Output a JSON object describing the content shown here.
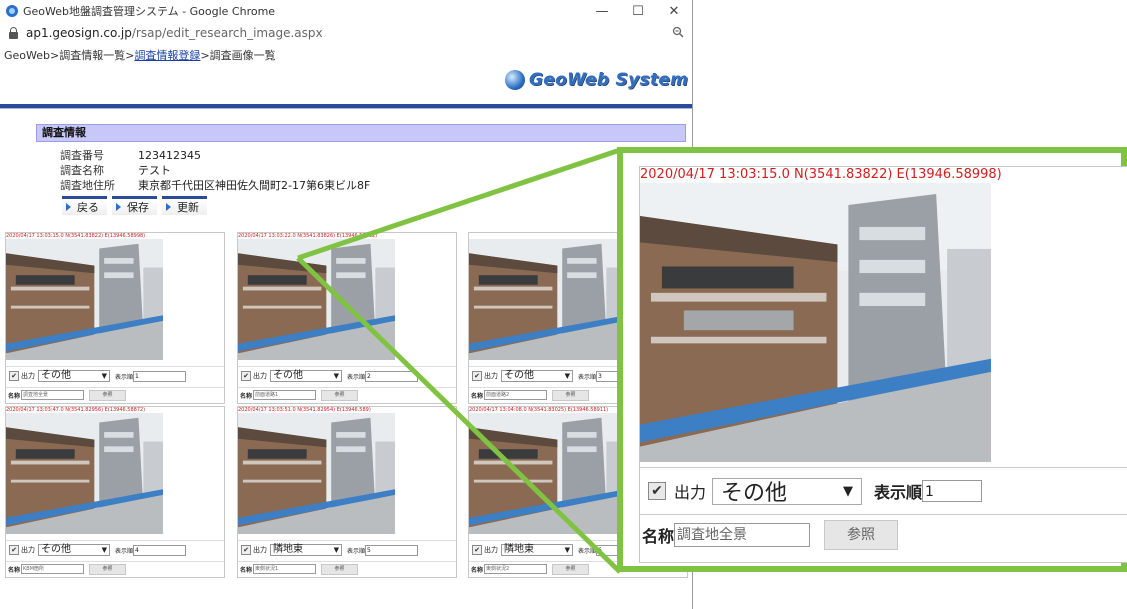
{
  "window": {
    "title": "GeoWeb地盤調査管理システム - Google Chrome",
    "url_host": "ap1.geosign.co.jp",
    "url_path": "/rsap/edit_research_image.aspx",
    "zoom_icon": "zoom-icon",
    "minimize": "—",
    "maximize": "☐",
    "close": "✕"
  },
  "breadcrumb": {
    "part1": "GeoWeb>調査情報一覧>",
    "link": "調査情報登録",
    "part2": ">調査画像一覧"
  },
  "logo": {
    "text": "GeoWeb System"
  },
  "info": {
    "heading": "調査情報",
    "rows": [
      {
        "label": "調査番号",
        "value": "123412345"
      },
      {
        "label": "調査名称",
        "value": "テスト"
      },
      {
        "label": "調査地住所",
        "value": "東京都千代田区神田佐久間町2-17第6東ビル8F"
      }
    ],
    "buttons": {
      "back": "戻る",
      "save": "保存",
      "update": "更新"
    }
  },
  "labels": {
    "output": "出力",
    "order": "表示順",
    "name": "名称",
    "browse": "参照",
    "check": "✔",
    "caret": "▼"
  },
  "cards": [
    {
      "ts": "2020/04/17 13:03:15.0 N(3541.83822) E(13946.58998)",
      "category": "その他",
      "order": "1",
      "name": "調査地全景"
    },
    {
      "ts": "2020/04/17 13:03:22.0 N(3541.83826) E(13946.58962)",
      "category": "その他",
      "order": "2",
      "name": "前面道路1"
    },
    {
      "ts": "",
      "category": "その他",
      "order": "3",
      "name": "前面道路2"
    },
    {
      "ts": "2020/04/17 13:03:47.0 N(3541.82956) E(13946.58872)",
      "category": "その他",
      "order": "4",
      "name": "KBM箇所"
    },
    {
      "ts": "2020/04/17 13:03:51.0 N(3541.82954) E(13946.589)",
      "category": "隣地東",
      "order": "5",
      "name": "東側状況1"
    },
    {
      "ts": "2020/04/17 13:04:08.0 N(3541.83025) E(13946.58911)",
      "category": "隣地東",
      "order": "6",
      "name": "東側状況2"
    }
  ],
  "zoom": {
    "ts": "2020/04/17 13:03:15.0 N(3541.83822) E(13946.58998)",
    "category": "その他",
    "order": "1",
    "name": "調査地全景"
  },
  "colors": {
    "callout": "#80c343",
    "timestamp": "#d21d1d",
    "header_bar": "#2a4b9a",
    "info_head": "#c8c8f8"
  }
}
